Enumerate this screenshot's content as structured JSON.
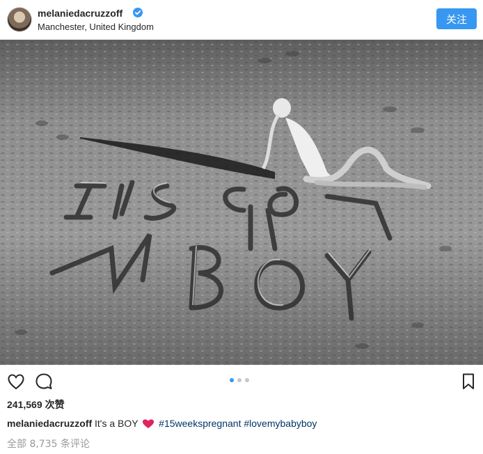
{
  "post": {
    "username": "melaniedacruzzoff",
    "location": "Manchester, United Kingdom",
    "follow_label": "关注",
    "verified_icon": "verified-badge-icon",
    "photo_alt_text": "",
    "carousel": {
      "total": 3,
      "active": 1
    },
    "likes_count": "241,569",
    "likes_unit": "次赞",
    "caption": {
      "user": "melaniedacruzzoff",
      "text": "It's a BOY",
      "emoji_icon": "red-heart-icon",
      "hashtags": [
        "#15weekspregnant",
        "#lovemybabyboy"
      ]
    },
    "comments_link": "全部 8,735 条评论",
    "sand_writing": [
      "It's a",
      "BOY"
    ]
  },
  "colors": {
    "accent": "#3897f0",
    "hashtag": "#003569",
    "heart": "#e0245e",
    "muted": "#999999"
  },
  "icons": {
    "like": "heart-outline-icon",
    "comment": "speech-bubble-icon",
    "save": "bookmark-icon"
  }
}
